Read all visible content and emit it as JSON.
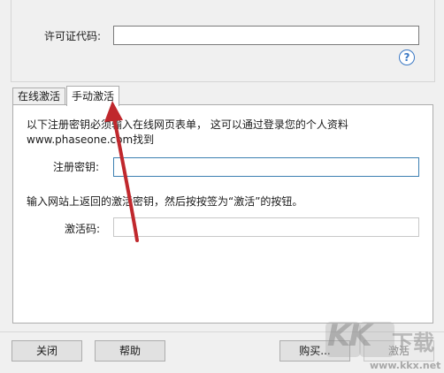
{
  "license": {
    "label": "许可证代码:",
    "value": ""
  },
  "tabs": [
    {
      "label": "在线激活",
      "active": false
    },
    {
      "label": "手动激活",
      "active": true
    }
  ],
  "manual": {
    "instruction_1": "以下注册密钥必须输入在线网页表单， 这可以通过登录您的个人资料 www.phaseone.com找到",
    "regkey_label": "注册密钥:",
    "regkey_value": "",
    "instruction_2": "输入网站上返回的激活密钥，然后按按签为“激活”的按钮。",
    "actcode_label": "激活码:",
    "actcode_value": ""
  },
  "buttons": {
    "close": "关闭",
    "help": "帮助",
    "buy": "购买...",
    "activate": "激活"
  },
  "icons": {
    "help": "question-circle-icon"
  },
  "watermark": {
    "brand": "KK",
    "cn": "下载",
    "url": "www.kkx.net"
  },
  "colors": {
    "accent": "#3a78c4",
    "arrow": "#c0282d"
  }
}
